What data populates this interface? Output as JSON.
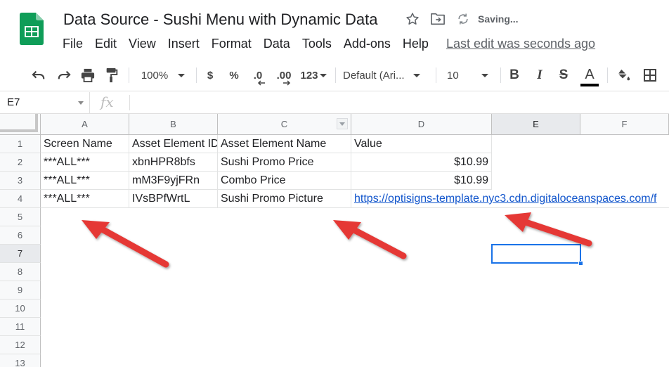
{
  "header": {
    "title": "Data Source - Sushi Menu with Dynamic Data",
    "saving_status": "Saving...",
    "menu": [
      "File",
      "Edit",
      "View",
      "Insert",
      "Format",
      "Data",
      "Tools",
      "Add-ons",
      "Help"
    ],
    "last_edit": "Last edit was seconds ago"
  },
  "toolbar": {
    "zoom": "100%",
    "currency": "$",
    "percent": "%",
    "decrease_decimals": ".0",
    "increase_decimals": ".00",
    "more_formats": "123",
    "font_family": "Default (Ari...",
    "font_size": "10",
    "bold": "B",
    "italic": "I",
    "strikethrough": "S",
    "text_color": "A"
  },
  "formula_bar": {
    "cell_ref": "E7",
    "fx_label": "fx",
    "value": ""
  },
  "grid": {
    "columns": [
      "A",
      "B",
      "C",
      "D",
      "E",
      "F"
    ],
    "selected_column": "E",
    "row_numbers": [
      "1",
      "2",
      "3",
      "4",
      "5",
      "6",
      "7",
      "8",
      "9",
      "10",
      "11",
      "12",
      "13"
    ],
    "selected_row": "7",
    "rows": [
      [
        "Screen Name",
        "Asset Element ID",
        "Asset Element Name",
        "Value"
      ],
      [
        "***ALL***",
        "xbnHPR8bfs",
        "Sushi Promo Price",
        "$10.99"
      ],
      [
        "***ALL***",
        "mM3F9yjFRn",
        "Combo Price",
        "$10.99"
      ],
      [
        "***ALL***",
        "IVsBPfWrtL",
        "Sushi Promo Picture",
        "https://optisigns-template.nyc3.cdn.digitaloceanspaces.com/f"
      ]
    ],
    "active_cell": "E7"
  },
  "colors": {
    "selection": "#1a73e8",
    "link": "#1155cc",
    "arrow": "#e53935",
    "sheets_green": "#0f9d58"
  }
}
